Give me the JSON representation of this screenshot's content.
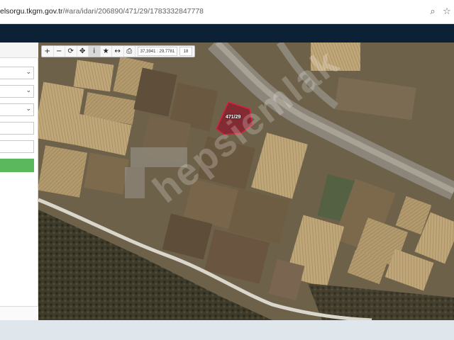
{
  "browser": {
    "url_host": "elsorgu.tkgm.gov.tr",
    "url_path": "/#ara/idari/206890/471/29/1783332847778",
    "zoom_icon": "zoom-icon",
    "star_icon": "star-icon"
  },
  "map": {
    "toolbar": {
      "coordinates": "37,3941 : 29,7781",
      "zoom_level": "18",
      "buttons": [
        {
          "icon": "zoom-in-icon",
          "glyph": "+"
        },
        {
          "icon": "zoom-out-icon",
          "glyph": "−"
        },
        {
          "icon": "refresh-icon",
          "glyph": "⟳"
        },
        {
          "icon": "pan-icon",
          "glyph": "✥"
        },
        {
          "icon": "info-icon",
          "glyph": "i"
        },
        {
          "icon": "star-icon",
          "glyph": "★"
        },
        {
          "icon": "measure-icon",
          "glyph": "↔"
        },
        {
          "icon": "print-icon",
          "glyph": "⎙"
        }
      ]
    },
    "parcel_label": "471/29",
    "watermark": "hepsiemlak",
    "colors": {
      "parcel_fill": "#8b1a2b",
      "parcel_stroke": "#d92040",
      "navbar": "#0d2136",
      "query_button": "#5cb85c"
    }
  }
}
